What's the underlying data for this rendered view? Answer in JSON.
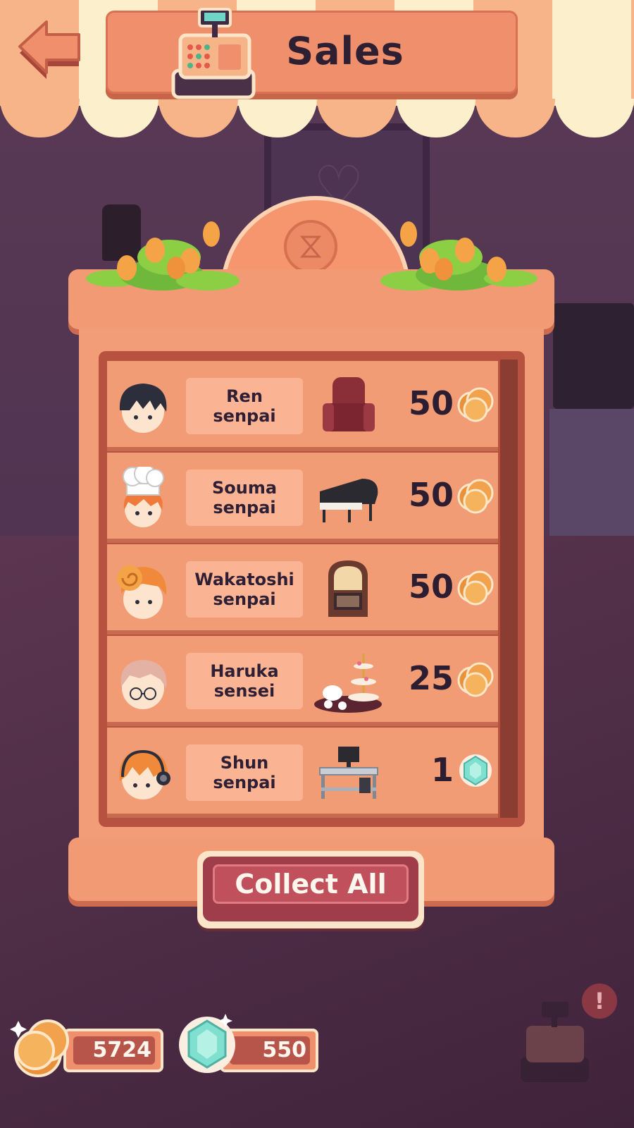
{
  "header": {
    "title": "Sales",
    "back_icon": "back-arrow-icon",
    "register_icon": "cash-register-icon"
  },
  "rows": [
    {
      "name": "Ren\nsenpai",
      "item_icon": "armchair-icon",
      "amount": "50",
      "currency": "coin"
    },
    {
      "name": "Souma\nsenpai",
      "item_icon": "grand-piano-icon",
      "amount": "50",
      "currency": "coin"
    },
    {
      "name": "Wakatoshi\nsenpai",
      "item_icon": "jukebox-icon",
      "amount": "50",
      "currency": "coin"
    },
    {
      "name": "Haruka\nsensei",
      "item_icon": "tea-set-icon",
      "amount": "25",
      "currency": "coin"
    },
    {
      "name": "Shun\nsenpai",
      "item_icon": "computer-desk-icon",
      "amount": "1",
      "currency": "gem"
    }
  ],
  "collect_button": {
    "label": "Collect All"
  },
  "currency": {
    "coins": "5724",
    "gems": "550"
  },
  "alert": {
    "symbol": "!"
  },
  "colors": {
    "plank": "#f29c76",
    "button": "#c0505b",
    "coin": "#f2a24c",
    "gem": "#7fe0d0"
  }
}
